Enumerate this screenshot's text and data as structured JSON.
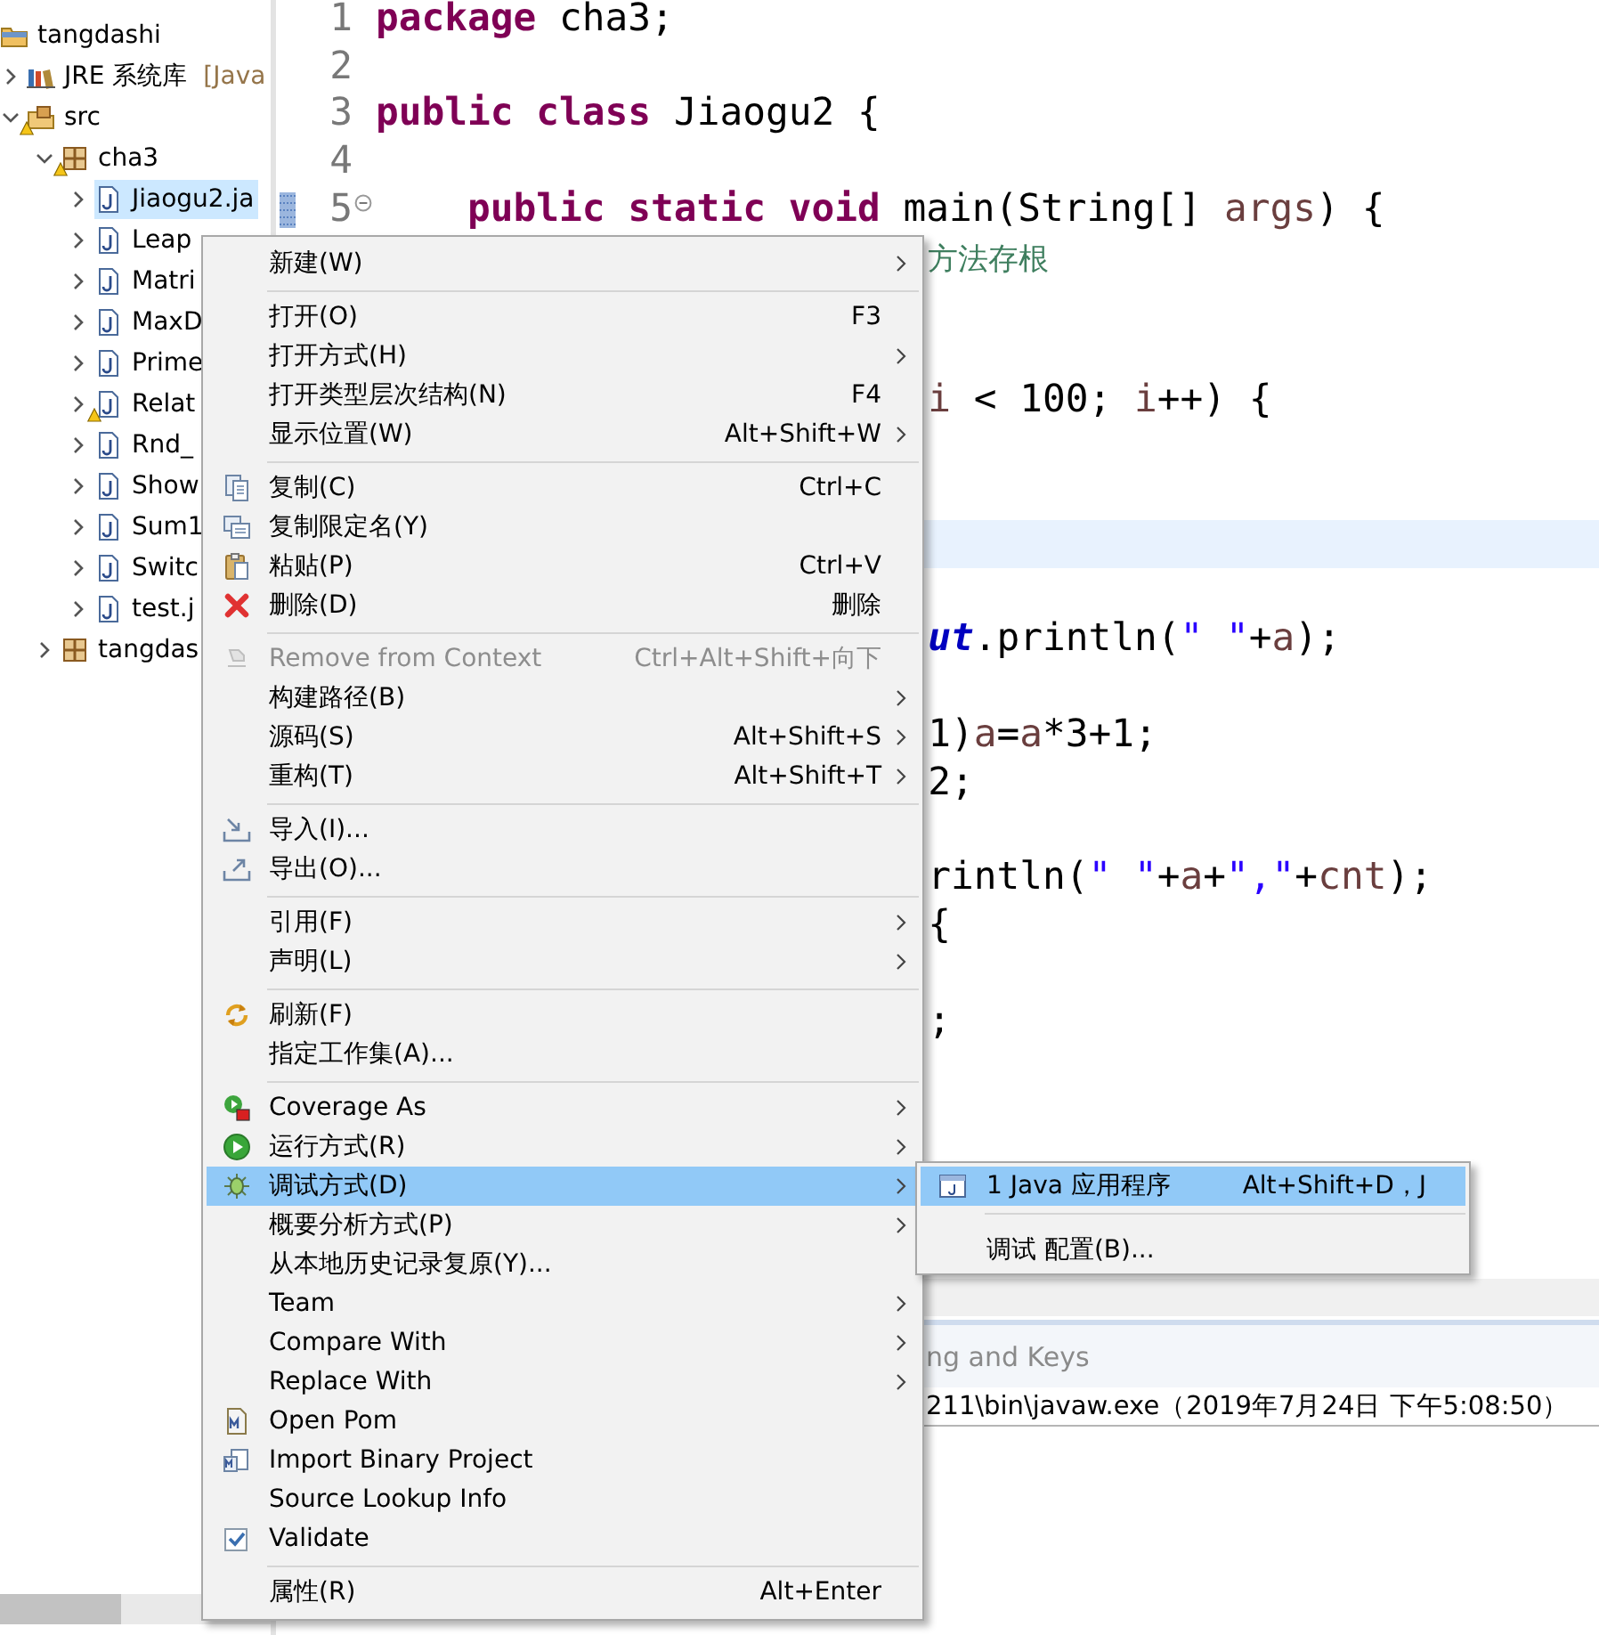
{
  "explorer": {
    "tree": [
      {
        "label": "tangdashi",
        "kind": "project",
        "selected": false,
        "warning": false,
        "children": [
          {
            "label": "JRE 系统库",
            "decoration": "[Java",
            "kind": "library",
            "expanded": false,
            "selected": false,
            "warning": false
          },
          {
            "label": "src",
            "kind": "source-folder",
            "expanded": true,
            "selected": false,
            "warning": true,
            "children": [
              {
                "label": "cha3",
                "kind": "package",
                "expanded": true,
                "selected": false,
                "warning": true,
                "children": [
                  {
                    "label": "Jiaogu2.ja",
                    "kind": "file",
                    "expanded": false,
                    "selected": true,
                    "warning": false
                  },
                  {
                    "label": "Leap",
                    "kind": "file",
                    "expanded": false,
                    "selected": false,
                    "warning": false
                  },
                  {
                    "label": "Matri",
                    "kind": "file",
                    "expanded": false,
                    "selected": false,
                    "warning": false
                  },
                  {
                    "label": "MaxD",
                    "kind": "file",
                    "expanded": false,
                    "selected": false,
                    "warning": false
                  },
                  {
                    "label": "Prime",
                    "kind": "file",
                    "expanded": false,
                    "selected": false,
                    "warning": false
                  },
                  {
                    "label": "Relat",
                    "kind": "file",
                    "expanded": false,
                    "selected": false,
                    "warning": true
                  },
                  {
                    "label": "Rnd_",
                    "kind": "file",
                    "expanded": false,
                    "selected": false,
                    "warning": false
                  },
                  {
                    "label": "Show",
                    "kind": "file",
                    "expanded": false,
                    "selected": false,
                    "warning": false
                  },
                  {
                    "label": "Sum1",
                    "kind": "file",
                    "expanded": false,
                    "selected": false,
                    "warning": false
                  },
                  {
                    "label": "Switc",
                    "kind": "file",
                    "expanded": false,
                    "selected": false,
                    "warning": false
                  },
                  {
                    "label": "test.j",
                    "kind": "file",
                    "expanded": false,
                    "selected": false,
                    "warning": false
                  }
                ]
              },
              {
                "label": "tangdas",
                "kind": "package",
                "expanded": false,
                "selected": false,
                "warning": false
              }
            ]
          }
        ]
      }
    ]
  },
  "editor": {
    "lines": [
      {
        "kind": "full",
        "number": "1",
        "current": false,
        "tokens": [
          {
            "kind": "kw",
            "text": "package"
          },
          {
            "kind": "plain",
            "text": " cha3;"
          }
        ]
      },
      {
        "kind": "blank",
        "number": "2",
        "current": false
      },
      {
        "kind": "full",
        "number": "3",
        "current": false,
        "tokens": [
          {
            "kind": "kw",
            "text": "public"
          },
          {
            "kind": "kw",
            "text": " class"
          },
          {
            "kind": "plain",
            "text": " Jiaogu2 {"
          }
        ]
      },
      {
        "kind": "blank",
        "number": "4",
        "current": false
      },
      {
        "kind": "full",
        "number": "5",
        "current": false,
        "expanded": true,
        "marker": true,
        "tokens": [
          {
            "kind": "kw",
            "text": "    public"
          },
          {
            "kind": "kw",
            "text": " static"
          },
          {
            "kind": "kw",
            "text": " void"
          },
          {
            "kind": "plain",
            "text": " main(String[] "
          },
          {
            "kind": "var",
            "text": "args"
          },
          {
            "kind": "plain",
            "text": ") {"
          }
        ]
      },
      {
        "kind": "partial",
        "current": false,
        "tokens": [
          {
            "kind": "comment",
            "text": "方法存根"
          }
        ]
      },
      {
        "kind": "blank",
        "current": false
      },
      {
        "kind": "blank",
        "current": false
      },
      {
        "kind": "partial",
        "current": false,
        "tokens": [
          {
            "kind": "var",
            "text": "i"
          },
          {
            "kind": "plain",
            "text": " < 100; "
          },
          {
            "kind": "var",
            "text": "i"
          },
          {
            "kind": "plain",
            "text": "++) {"
          }
        ]
      },
      {
        "kind": "blank",
        "current": false
      },
      {
        "kind": "blank",
        "current": false
      },
      {
        "kind": "blank",
        "current": true
      },
      {
        "kind": "blank",
        "current": false
      },
      {
        "kind": "partial",
        "current": false,
        "tokens": [
          {
            "kind": "field",
            "text": "ut"
          },
          {
            "kind": "plain",
            "text": ".println("
          },
          {
            "kind": "str",
            "text": "\" \""
          },
          {
            "kind": "plain",
            "text": "+"
          },
          {
            "kind": "var",
            "text": "a"
          },
          {
            "kind": "plain",
            "text": ");"
          }
        ]
      },
      {
        "kind": "blank",
        "current": false
      },
      {
        "kind": "partial",
        "current": false,
        "tokens": [
          {
            "kind": "plain",
            "text": "1)"
          },
          {
            "kind": "var",
            "text": "a"
          },
          {
            "kind": "plain",
            "text": "="
          },
          {
            "kind": "var",
            "text": "a"
          },
          {
            "kind": "plain",
            "text": "*3+1;"
          }
        ]
      },
      {
        "kind": "partial",
        "current": false,
        "tokens": [
          {
            "kind": "plain",
            "text": "2;"
          }
        ]
      },
      {
        "kind": "blank",
        "current": false
      },
      {
        "kind": "partial",
        "current": false,
        "tokens": [
          {
            "kind": "plain",
            "text": "rintln("
          },
          {
            "kind": "str",
            "text": "\" \""
          },
          {
            "kind": "plain",
            "text": "+"
          },
          {
            "kind": "var",
            "text": "a"
          },
          {
            "kind": "plain",
            "text": "+"
          },
          {
            "kind": "str",
            "text": "\",\""
          },
          {
            "kind": "plain",
            "text": "+"
          },
          {
            "kind": "var",
            "text": "cnt"
          },
          {
            "kind": "plain",
            "text": ");"
          }
        ]
      },
      {
        "kind": "partial",
        "current": false,
        "tokens": [
          {
            "kind": "plain",
            "text": "{"
          }
        ]
      },
      {
        "kind": "blank",
        "current": false
      },
      {
        "kind": "partial",
        "current": false,
        "tokens": [
          {
            "kind": "plain",
            "text": ";"
          }
        ]
      }
    ]
  },
  "bottom_panel": {
    "tab_text": "ng and Keys",
    "console_line": "211\\bin\\javaw.exe（2019年7月24日 下午5:08:50）"
  },
  "context_menu": {
    "groups": [
      [
        {
          "label": "新建(W)",
          "submenu": true,
          "selected": false,
          "disabled": false
        }
      ],
      [
        {
          "label": "打开(O)",
          "shortcut": "F3",
          "submenu": false,
          "selected": false,
          "disabled": false
        },
        {
          "label": "打开方式(H)",
          "submenu": true,
          "selected": false,
          "disabled": false
        },
        {
          "label": "打开类型层次结构(N)",
          "shortcut": "F4",
          "submenu": false,
          "selected": false,
          "disabled": false
        },
        {
          "label": "显示位置(W)",
          "shortcut": "Alt+Shift+W",
          "submenu": true,
          "selected": false,
          "disabled": false
        }
      ],
      [
        {
          "label": "复制(C)",
          "shortcut": "Ctrl+C",
          "submenu": false,
          "selected": false,
          "disabled": false
        },
        {
          "label": "复制限定名(Y)",
          "submenu": false,
          "selected": false,
          "disabled": false
        },
        {
          "label": "粘贴(P)",
          "shortcut": "Ctrl+V",
          "submenu": false,
          "selected": false,
          "disabled": false
        },
        {
          "label": "删除(D)",
          "shortcut": "删除",
          "submenu": false,
          "selected": false,
          "disabled": false
        }
      ],
      [
        {
          "label": "Remove from Context",
          "shortcut": "Ctrl+Alt+Shift+向下",
          "submenu": false,
          "selected": false,
          "disabled": true
        },
        {
          "label": "构建路径(B)",
          "submenu": true,
          "selected": false,
          "disabled": false
        },
        {
          "label": "源码(S)",
          "shortcut": "Alt+Shift+S",
          "submenu": true,
          "selected": false,
          "disabled": false
        },
        {
          "label": "重构(T)",
          "shortcut": "Alt+Shift+T",
          "submenu": true,
          "selected": false,
          "disabled": false
        }
      ],
      [
        {
          "label": "导入(I)...",
          "submenu": false,
          "selected": false,
          "disabled": false
        },
        {
          "label": "导出(O)...",
          "submenu": false,
          "selected": false,
          "disabled": false
        }
      ],
      [
        {
          "label": "引用(F)",
          "submenu": true,
          "selected": false,
          "disabled": false
        },
        {
          "label": "声明(L)",
          "submenu": true,
          "selected": false,
          "disabled": false
        }
      ],
      [
        {
          "label": "刷新(F)",
          "submenu": false,
          "selected": false,
          "disabled": false
        },
        {
          "label": "指定工作集(A)...",
          "submenu": false,
          "selected": false,
          "disabled": false
        }
      ],
      [
        {
          "label": "Coverage As",
          "submenu": true,
          "selected": false,
          "disabled": false
        },
        {
          "label": "运行方式(R)",
          "submenu": true,
          "selected": false,
          "disabled": false
        },
        {
          "label": "调试方式(D)",
          "submenu": true,
          "selected": true,
          "disabled": false
        },
        {
          "label": "概要分析方式(P)",
          "submenu": true,
          "selected": false,
          "disabled": false
        },
        {
          "label": "从本地历史记录复原(Y)...",
          "submenu": false,
          "selected": false,
          "disabled": false
        },
        {
          "label": "Team",
          "submenu": true,
          "selected": false,
          "disabled": false
        },
        {
          "label": "Compare With",
          "submenu": true,
          "selected": false,
          "disabled": false
        },
        {
          "label": "Replace With",
          "submenu": true,
          "selected": false,
          "disabled": false
        },
        {
          "label": "Open Pom",
          "submenu": false,
          "selected": false,
          "disabled": false
        },
        {
          "label": "Import Binary Project",
          "submenu": false,
          "selected": false,
          "disabled": false
        },
        {
          "label": "Source Lookup Info",
          "submenu": false,
          "selected": false,
          "disabled": false
        },
        {
          "label": "Validate",
          "submenu": false,
          "selected": false,
          "disabled": false
        }
      ],
      [
        {
          "label": "属性(R)",
          "shortcut": "Alt+Enter",
          "submenu": false,
          "selected": false,
          "disabled": false
        }
      ]
    ]
  },
  "submenu": {
    "groups": [
      [
        {
          "label": "1 Java 应用程序",
          "shortcut": "Alt+Shift+D，J",
          "selected": true
        }
      ],
      [
        {
          "label": "调试 配置(B)...",
          "selected": false
        }
      ]
    ]
  }
}
